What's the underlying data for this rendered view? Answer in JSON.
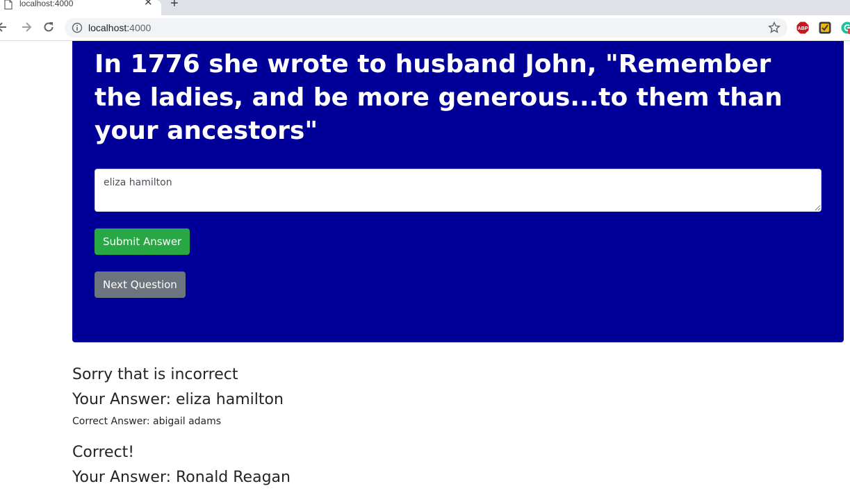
{
  "browser": {
    "tab_title": "localhost:4000",
    "url_host": "localhost:",
    "url_port": "4000",
    "icons": [
      "page-icon",
      "close-icon",
      "plus-icon",
      "back-icon",
      "forward-icon",
      "reload-icon",
      "info-icon",
      "star-icon",
      "adblock-icon",
      "checkmark-extension-icon",
      "grammarly-icon"
    ]
  },
  "quiz": {
    "question": "In 1776 she wrote to husband John, \"Remember the ladies, and be more generous...to them than your ancestors\"",
    "answer_value": "eliza hamilton",
    "submit_label": "Submit Answer",
    "next_label": "Next Question"
  },
  "results": [
    {
      "status": "Sorry that is incorrect",
      "your_answer": "Your Answer: eliza hamilton",
      "correct_answer": "Correct Answer: abigail adams"
    },
    {
      "status": "Correct!",
      "your_answer": "Your Answer: Ronald Reagan"
    }
  ],
  "colors": {
    "jumbotron_bg": "#000099",
    "submit_bg": "#28a745",
    "next_bg": "#6c757d",
    "abp_red": "#c4161c"
  }
}
